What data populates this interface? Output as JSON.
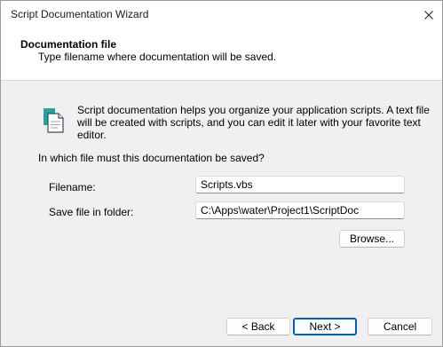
{
  "window": {
    "title": "Script Documentation Wizard"
  },
  "header": {
    "title": "Documentation file",
    "subtitle": "Type filename where documentation will be saved."
  },
  "intro": {
    "icon": "document-icon",
    "text": "Script documentation helps you organize your application scripts. A text file will be created with scripts, and you can edit it later with your favorite text editor."
  },
  "question": "In which file must this documentation be saved?",
  "form": {
    "filename_label": "Filename:",
    "filename_value": "Scripts.vbs",
    "folder_label": "Save file in folder:",
    "folder_value": "C:\\Apps\\water\\Project1\\ScriptDoc",
    "browse_label": "Browse..."
  },
  "footer": {
    "back_label": "< Back",
    "next_label": "Next >",
    "cancel_label": "Cancel"
  },
  "colors": {
    "accent": "#005fb8",
    "icon_teal": "#1fa3a3"
  }
}
